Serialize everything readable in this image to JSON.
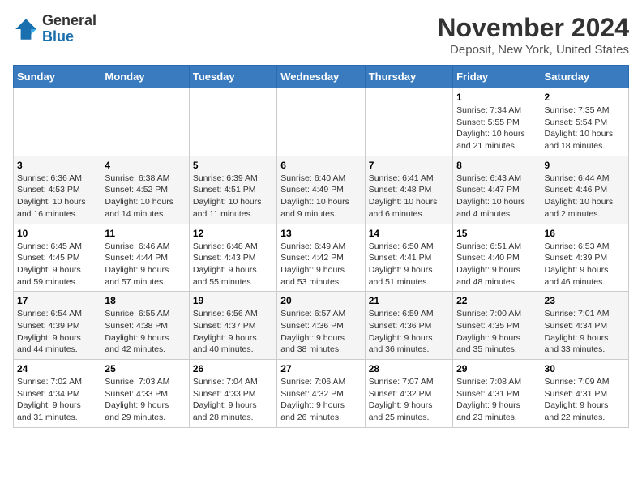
{
  "header": {
    "logo_general": "General",
    "logo_blue": "Blue",
    "month_title": "November 2024",
    "location": "Deposit, New York, United States"
  },
  "weekdays": [
    "Sunday",
    "Monday",
    "Tuesday",
    "Wednesday",
    "Thursday",
    "Friday",
    "Saturday"
  ],
  "weeks": [
    [
      {
        "day": "",
        "info": ""
      },
      {
        "day": "",
        "info": ""
      },
      {
        "day": "",
        "info": ""
      },
      {
        "day": "",
        "info": ""
      },
      {
        "day": "",
        "info": ""
      },
      {
        "day": "1",
        "info": "Sunrise: 7:34 AM\nSunset: 5:55 PM\nDaylight: 10 hours\nand 21 minutes."
      },
      {
        "day": "2",
        "info": "Sunrise: 7:35 AM\nSunset: 5:54 PM\nDaylight: 10 hours\nand 18 minutes."
      }
    ],
    [
      {
        "day": "3",
        "info": "Sunrise: 6:36 AM\nSunset: 4:53 PM\nDaylight: 10 hours\nand 16 minutes."
      },
      {
        "day": "4",
        "info": "Sunrise: 6:38 AM\nSunset: 4:52 PM\nDaylight: 10 hours\nand 14 minutes."
      },
      {
        "day": "5",
        "info": "Sunrise: 6:39 AM\nSunset: 4:51 PM\nDaylight: 10 hours\nand 11 minutes."
      },
      {
        "day": "6",
        "info": "Sunrise: 6:40 AM\nSunset: 4:49 PM\nDaylight: 10 hours\nand 9 minutes."
      },
      {
        "day": "7",
        "info": "Sunrise: 6:41 AM\nSunset: 4:48 PM\nDaylight: 10 hours\nand 6 minutes."
      },
      {
        "day": "8",
        "info": "Sunrise: 6:43 AM\nSunset: 4:47 PM\nDaylight: 10 hours\nand 4 minutes."
      },
      {
        "day": "9",
        "info": "Sunrise: 6:44 AM\nSunset: 4:46 PM\nDaylight: 10 hours\nand 2 minutes."
      }
    ],
    [
      {
        "day": "10",
        "info": "Sunrise: 6:45 AM\nSunset: 4:45 PM\nDaylight: 9 hours\nand 59 minutes."
      },
      {
        "day": "11",
        "info": "Sunrise: 6:46 AM\nSunset: 4:44 PM\nDaylight: 9 hours\nand 57 minutes."
      },
      {
        "day": "12",
        "info": "Sunrise: 6:48 AM\nSunset: 4:43 PM\nDaylight: 9 hours\nand 55 minutes."
      },
      {
        "day": "13",
        "info": "Sunrise: 6:49 AM\nSunset: 4:42 PM\nDaylight: 9 hours\nand 53 minutes."
      },
      {
        "day": "14",
        "info": "Sunrise: 6:50 AM\nSunset: 4:41 PM\nDaylight: 9 hours\nand 51 minutes."
      },
      {
        "day": "15",
        "info": "Sunrise: 6:51 AM\nSunset: 4:40 PM\nDaylight: 9 hours\nand 48 minutes."
      },
      {
        "day": "16",
        "info": "Sunrise: 6:53 AM\nSunset: 4:39 PM\nDaylight: 9 hours\nand 46 minutes."
      }
    ],
    [
      {
        "day": "17",
        "info": "Sunrise: 6:54 AM\nSunset: 4:39 PM\nDaylight: 9 hours\nand 44 minutes."
      },
      {
        "day": "18",
        "info": "Sunrise: 6:55 AM\nSunset: 4:38 PM\nDaylight: 9 hours\nand 42 minutes."
      },
      {
        "day": "19",
        "info": "Sunrise: 6:56 AM\nSunset: 4:37 PM\nDaylight: 9 hours\nand 40 minutes."
      },
      {
        "day": "20",
        "info": "Sunrise: 6:57 AM\nSunset: 4:36 PM\nDaylight: 9 hours\nand 38 minutes."
      },
      {
        "day": "21",
        "info": "Sunrise: 6:59 AM\nSunset: 4:36 PM\nDaylight: 9 hours\nand 36 minutes."
      },
      {
        "day": "22",
        "info": "Sunrise: 7:00 AM\nSunset: 4:35 PM\nDaylight: 9 hours\nand 35 minutes."
      },
      {
        "day": "23",
        "info": "Sunrise: 7:01 AM\nSunset: 4:34 PM\nDaylight: 9 hours\nand 33 minutes."
      }
    ],
    [
      {
        "day": "24",
        "info": "Sunrise: 7:02 AM\nSunset: 4:34 PM\nDaylight: 9 hours\nand 31 minutes."
      },
      {
        "day": "25",
        "info": "Sunrise: 7:03 AM\nSunset: 4:33 PM\nDaylight: 9 hours\nand 29 minutes."
      },
      {
        "day": "26",
        "info": "Sunrise: 7:04 AM\nSunset: 4:33 PM\nDaylight: 9 hours\nand 28 minutes."
      },
      {
        "day": "27",
        "info": "Sunrise: 7:06 AM\nSunset: 4:32 PM\nDaylight: 9 hours\nand 26 minutes."
      },
      {
        "day": "28",
        "info": "Sunrise: 7:07 AM\nSunset: 4:32 PM\nDaylight: 9 hours\nand 25 minutes."
      },
      {
        "day": "29",
        "info": "Sunrise: 7:08 AM\nSunset: 4:31 PM\nDaylight: 9 hours\nand 23 minutes."
      },
      {
        "day": "30",
        "info": "Sunrise: 7:09 AM\nSunset: 4:31 PM\nDaylight: 9 hours\nand 22 minutes."
      }
    ]
  ]
}
